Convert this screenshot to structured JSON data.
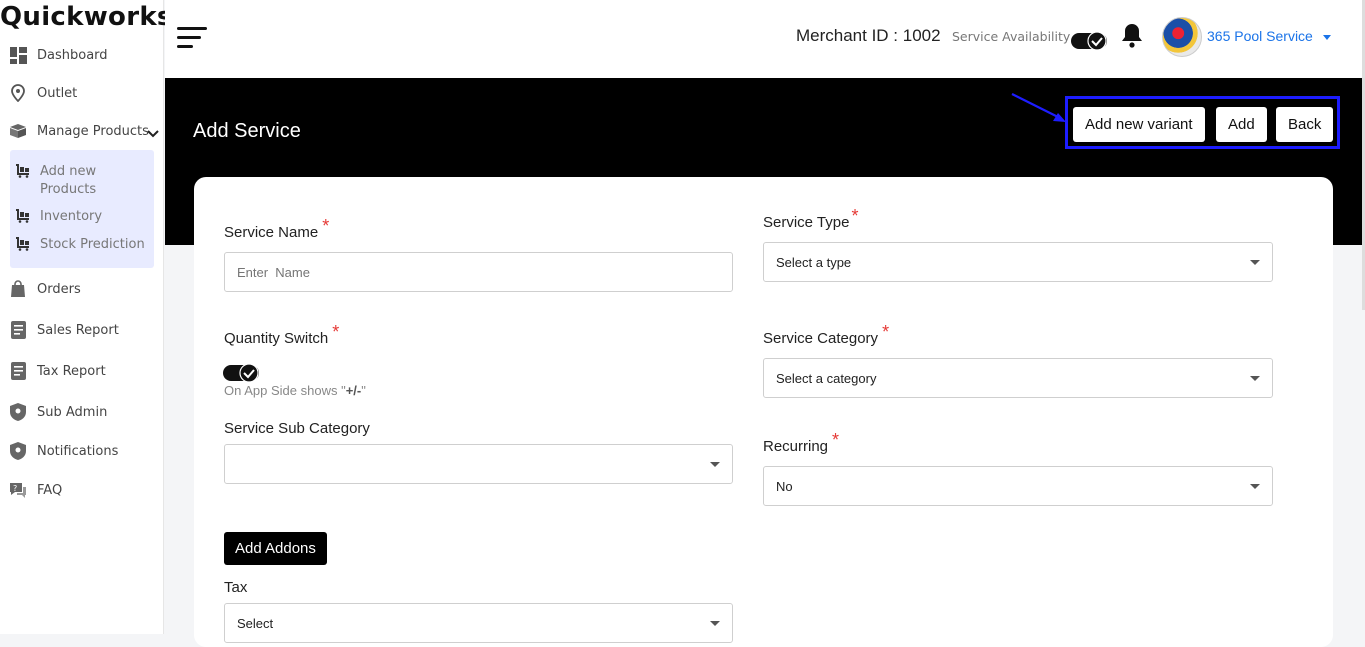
{
  "app": {
    "logo": "Quickworks"
  },
  "sidebar": {
    "items": [
      {
        "label": "Dashboard",
        "icon": "dashboard-icon"
      },
      {
        "label": "Outlet",
        "icon": "location-pin-icon"
      },
      {
        "label": "Manage Products",
        "icon": "box-icon"
      },
      {
        "label": "Orders",
        "icon": "shopping-bag-icon"
      },
      {
        "label": "Sales Report",
        "icon": "report-icon"
      },
      {
        "label": "Tax Report",
        "icon": "report-icon"
      },
      {
        "label": "Sub Admin",
        "icon": "shield-icon"
      },
      {
        "label": "Notifications",
        "icon": "shield-icon"
      },
      {
        "label": "FAQ",
        "icon": "faq-icon"
      }
    ],
    "subitems": [
      {
        "label": "Add new Products",
        "icon": "cart-icon"
      },
      {
        "label": "Inventory",
        "icon": "cart-icon"
      },
      {
        "label": "Stock Prediction",
        "icon": "cart-icon"
      }
    ]
  },
  "header": {
    "merchant_id": "Merchant ID : 1002",
    "service_availability": "Service Availability",
    "service_availability_on": true,
    "user_name": "365 Pool Service"
  },
  "page": {
    "title": "Add Service",
    "buttons": {
      "add_variant": "Add new variant",
      "add": "Add",
      "back": "Back"
    }
  },
  "form": {
    "service_name": {
      "label": "Service Name",
      "placeholder": "Enter  Name",
      "value": ""
    },
    "service_type": {
      "label": "Service Type",
      "value": "Select a type"
    },
    "quantity_switch": {
      "label": "Quantity Switch",
      "on": true,
      "helper_prefix": "On App Side shows \"",
      "helper_bold": "+/-",
      "helper_suffix": "\""
    },
    "service_category": {
      "label": "Service Category",
      "value": "Select a category"
    },
    "service_sub_category": {
      "label": "Service Sub Category",
      "value": ""
    },
    "recurring": {
      "label": "Recurring",
      "value": "No"
    },
    "add_addons": "Add Addons",
    "tax": {
      "label": "Tax",
      "value": "Select"
    }
  },
  "colors": {
    "accent_blue": "#1a73e8",
    "highlight": "#1d1dff",
    "required": "#e53935",
    "banner": "#000000"
  }
}
